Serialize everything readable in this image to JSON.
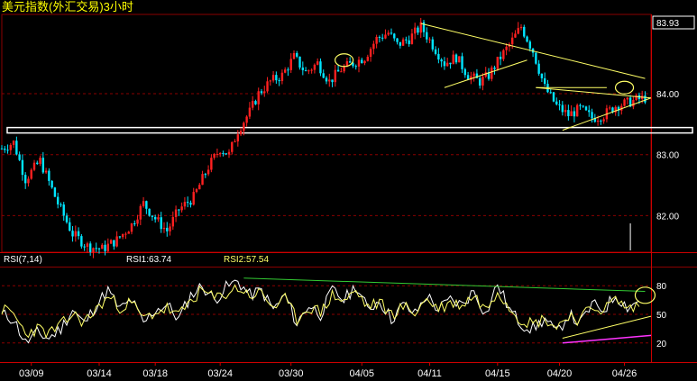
{
  "window": {
    "title": "美元指数(外汇交易)3小时"
  },
  "colors": {
    "background": "#000000",
    "up_candle": "#ff2020",
    "down_candle": "#00e5ff",
    "grid": "#8b0000",
    "axis_text": "#ffffff",
    "rsi_fast": "#ffffff",
    "rsi_slow": "#ffff66",
    "trend_yellow": "#ffff66",
    "trend_green": "#33cc33",
    "trend_magenta": "#ff33ff",
    "highlight_box": "#ffffff",
    "title": "#ffff00"
  },
  "rsi_header": {
    "name": "RSI(7,14)",
    "rsi1_label": "RSI1:63.74",
    "rsi2_label": "RSI2:57.54"
  },
  "chart_data": [
    {
      "type": "candlestick",
      "title": "美元指数(外汇交易)3小时",
      "last_price_label": "83.93",
      "y_ticks": [
        "84.00",
        "83.00",
        "82.00"
      ],
      "y_tick_values": [
        84.0,
        83.0,
        82.0
      ],
      "ylim": [
        81.4,
        85.3
      ],
      "grid": true,
      "close_path": [
        [
          0,
          83.1
        ],
        [
          4,
          83.2
        ],
        [
          8,
          82.6
        ],
        [
          13,
          82.9
        ],
        [
          19,
          82.2
        ],
        [
          24,
          81.7
        ],
        [
          29,
          81.5
        ],
        [
          34,
          81.45
        ],
        [
          39,
          81.6
        ],
        [
          44,
          81.85
        ],
        [
          48,
          82.2
        ],
        [
          52,
          81.95
        ],
        [
          56,
          81.75
        ],
        [
          60,
          82.1
        ],
        [
          65,
          82.3
        ],
        [
          70,
          82.8
        ],
        [
          74,
          83.1
        ],
        [
          77,
          83.0
        ],
        [
          80,
          83.4
        ],
        [
          84,
          83.7
        ],
        [
          87,
          84.0
        ],
        [
          91,
          84.2
        ],
        [
          95,
          84.3
        ],
        [
          99,
          84.6
        ],
        [
          103,
          84.35
        ],
        [
          107,
          84.5
        ],
        [
          111,
          84.2
        ],
        [
          115,
          84.4
        ],
        [
          119,
          84.5
        ],
        [
          123,
          84.6
        ],
        [
          127,
          84.9
        ],
        [
          131,
          85.0
        ],
        [
          134,
          84.8
        ],
        [
          138,
          84.9
        ],
        [
          142,
          85.1
        ],
        [
          146,
          84.8
        ],
        [
          150,
          84.5
        ],
        [
          154,
          84.6
        ],
        [
          158,
          84.3
        ],
        [
          162,
          84.2
        ],
        [
          165,
          84.3
        ],
        [
          169,
          84.6
        ],
        [
          172,
          84.8
        ],
        [
          176,
          85.1
        ],
        [
          180,
          84.7
        ],
        [
          184,
          84.1
        ],
        [
          188,
          83.8
        ],
        [
          192,
          83.65
        ],
        [
          196,
          83.75
        ],
        [
          200,
          83.6
        ],
        [
          204,
          83.65
        ],
        [
          208,
          83.8
        ],
        [
          212,
          83.85
        ],
        [
          215,
          83.9
        ],
        [
          218,
          83.93
        ]
      ],
      "x_axis_labels": [
        "03/09",
        "03/14",
        "03/18",
        "03/24",
        "03/30",
        "04/05",
        "04/11",
        "04/15",
        "04/20",
        "04/26"
      ],
      "x_axis_positions": [
        10,
        33,
        52,
        74,
        98,
        122,
        145,
        168,
        189,
        211
      ],
      "x_range": [
        0,
        220
      ],
      "annotations": {
        "support_line": {
          "y": 83.4,
          "label": ""
        },
        "big_triangle": {
          "upper": [
            [
              142,
              85.15
            ],
            [
              218,
              84.25
            ]
          ],
          "lower": [
            [
              150,
              84.1
            ],
            [
              178,
              84.55
            ]
          ]
        },
        "small_triangle": {
          "upper": [
            [
              181,
              84.1
            ],
            [
              220,
              83.93
            ]
          ],
          "lower": [
            [
              190,
              83.4
            ],
            [
              220,
              83.93
            ]
          ]
        },
        "ellipses": [
          {
            "x": 116,
            "y": 84.55
          },
          {
            "x": 211,
            "y": 84.1
          }
        ]
      }
    },
    {
      "type": "line",
      "title": "RSI(7,14)",
      "series": [
        {
          "name": "RSI1",
          "last_value": 63.74
        },
        {
          "name": "RSI2",
          "last_value": 57.54
        }
      ],
      "y_ticks": [
        "80",
        "50",
        "20"
      ],
      "y_tick_values": [
        80,
        50,
        20
      ],
      "ylim": [
        0,
        100
      ],
      "rsi1_path": [
        [
          0,
          50
        ],
        [
          4,
          45
        ],
        [
          8,
          20
        ],
        [
          12,
          30
        ],
        [
          16,
          25
        ],
        [
          20,
          35
        ],
        [
          24,
          55
        ],
        [
          28,
          40
        ],
        [
          32,
          60
        ],
        [
          36,
          75
        ],
        [
          40,
          55
        ],
        [
          44,
          65
        ],
        [
          48,
          40
        ],
        [
          52,
          55
        ],
        [
          56,
          60
        ],
        [
          60,
          45
        ],
        [
          64,
          70
        ],
        [
          68,
          80
        ],
        [
          72,
          65
        ],
        [
          76,
          78
        ],
        [
          80,
          85
        ],
        [
          84,
          70
        ],
        [
          88,
          75
        ],
        [
          92,
          55
        ],
        [
          96,
          70
        ],
        [
          100,
          40
        ],
        [
          104,
          60
        ],
        [
          108,
          50
        ],
        [
          112,
          75
        ],
        [
          116,
          65
        ],
        [
          120,
          80
        ],
        [
          124,
          55
        ],
        [
          128,
          65
        ],
        [
          132,
          45
        ],
        [
          136,
          60
        ],
        [
          140,
          50
        ],
        [
          144,
          70
        ],
        [
          148,
          55
        ],
        [
          152,
          65
        ],
        [
          156,
          60
        ],
        [
          160,
          75
        ],
        [
          164,
          50
        ],
        [
          168,
          82
        ],
        [
          172,
          55
        ],
        [
          176,
          40
        ],
        [
          180,
          35
        ],
        [
          184,
          45
        ],
        [
          188,
          30
        ],
        [
          192,
          50
        ],
        [
          196,
          40
        ],
        [
          200,
          60
        ],
        [
          204,
          55
        ],
        [
          208,
          70
        ],
        [
          212,
          58
        ],
        [
          216,
          64
        ]
      ],
      "rsi2_path": [
        [
          0,
          55
        ],
        [
          4,
          50
        ],
        [
          8,
          30
        ],
        [
          12,
          35
        ],
        [
          16,
          30
        ],
        [
          20,
          38
        ],
        [
          24,
          50
        ],
        [
          28,
          42
        ],
        [
          32,
          55
        ],
        [
          36,
          68
        ],
        [
          40,
          58
        ],
        [
          44,
          62
        ],
        [
          48,
          45
        ],
        [
          52,
          52
        ],
        [
          56,
          56
        ],
        [
          60,
          48
        ],
        [
          64,
          65
        ],
        [
          68,
          75
        ],
        [
          72,
          66
        ],
        [
          76,
          72
        ],
        [
          80,
          78
        ],
        [
          84,
          70
        ],
        [
          88,
          72
        ],
        [
          92,
          58
        ],
        [
          96,
          65
        ],
        [
          100,
          45
        ],
        [
          104,
          58
        ],
        [
          108,
          52
        ],
        [
          112,
          70
        ],
        [
          116,
          64
        ],
        [
          120,
          74
        ],
        [
          124,
          58
        ],
        [
          128,
          62
        ],
        [
          132,
          50
        ],
        [
          136,
          58
        ],
        [
          140,
          52
        ],
        [
          144,
          66
        ],
        [
          148,
          56
        ],
        [
          152,
          62
        ],
        [
          156,
          60
        ],
        [
          160,
          70
        ],
        [
          164,
          55
        ],
        [
          168,
          76
        ],
        [
          172,
          58
        ],
        [
          176,
          45
        ],
        [
          180,
          40
        ],
        [
          184,
          46
        ],
        [
          188,
          36
        ],
        [
          192,
          50
        ],
        [
          196,
          44
        ],
        [
          200,
          58
        ],
        [
          204,
          55
        ],
        [
          208,
          66
        ],
        [
          212,
          56
        ],
        [
          216,
          58
        ]
      ],
      "annotations": {
        "green_trendline": [
          [
            82,
            88
          ],
          [
            218,
            74
          ]
        ],
        "yellow_trendline": [
          [
            190,
            25
          ],
          [
            220,
            48
          ]
        ],
        "magenta_trendline": [
          [
            190,
            20
          ],
          [
            220,
            28
          ]
        ],
        "ellipse": {
          "x": 218,
          "y": 70
        }
      }
    }
  ]
}
